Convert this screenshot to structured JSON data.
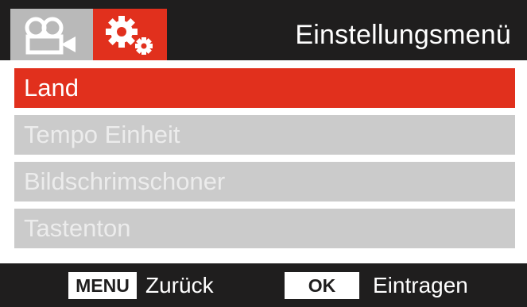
{
  "header": {
    "title": "Einstellungsmenü",
    "tabs": [
      {
        "icon": "video-camera-icon",
        "active": false
      },
      {
        "icon": "gears-icon",
        "active": true
      }
    ]
  },
  "menu": {
    "items": [
      {
        "label": "Land",
        "selected": true
      },
      {
        "label": "Tempo Einheit",
        "selected": false
      },
      {
        "label": "Bildschrimschoner",
        "selected": false
      },
      {
        "label": "Tastenton",
        "selected": false
      }
    ]
  },
  "footer": {
    "menu_key": "MENU",
    "menu_action": "Zurück",
    "ok_key": "OK",
    "ok_action": "Eintragen"
  },
  "colors": {
    "background_dark": "#1f1e1e",
    "accent": "#e1301d",
    "inactive_tab": "#b9b9b9",
    "item_inactive": "#cbcbcb"
  }
}
